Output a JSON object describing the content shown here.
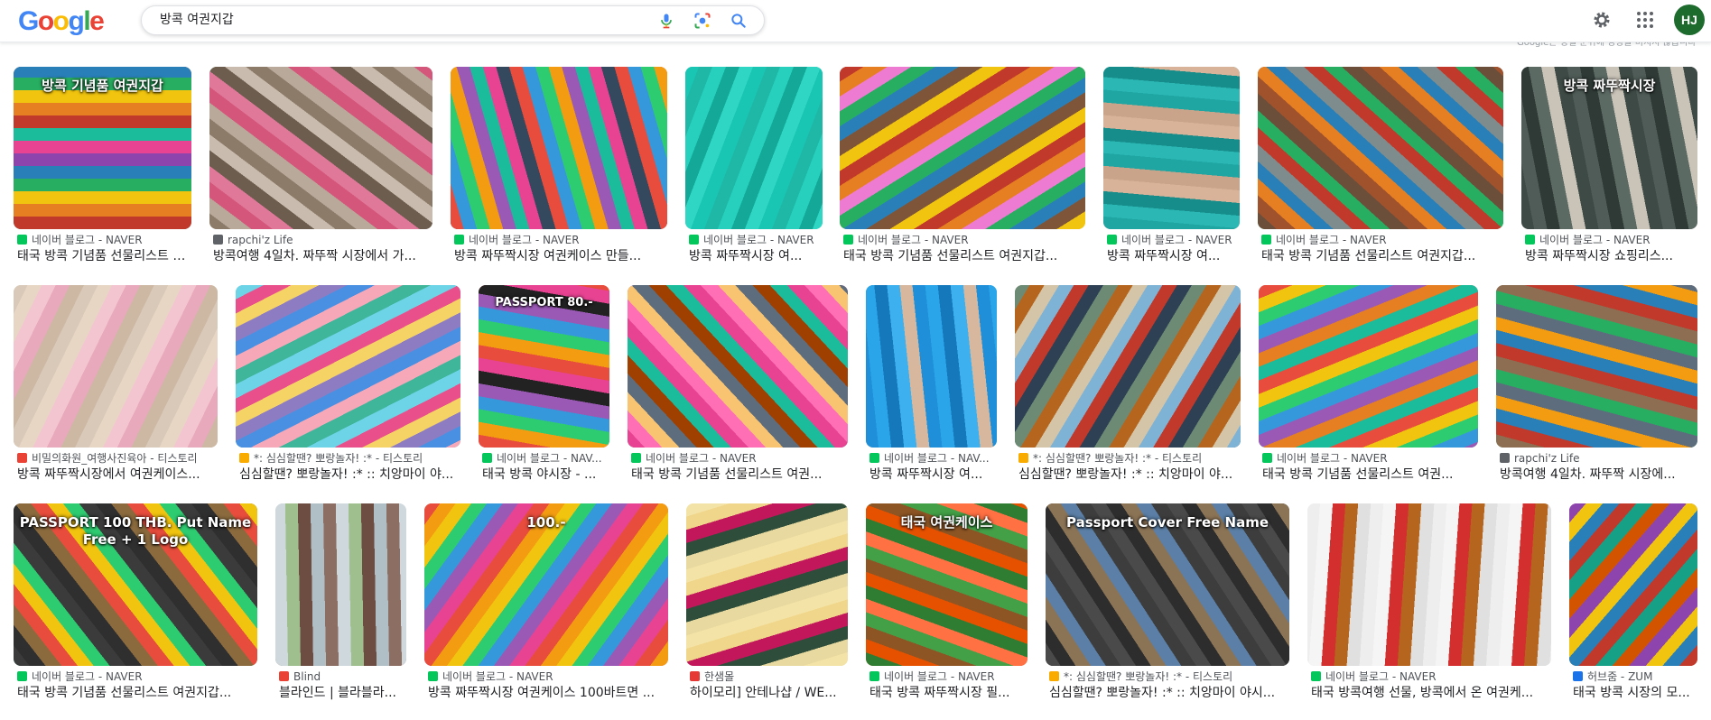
{
  "header": {
    "logo": [
      "G",
      "o",
      "o",
      "g",
      "l",
      "e"
    ],
    "logo_colors": [
      "#4285f4",
      "#ea4335",
      "#fbbc05",
      "#4285f4",
      "#34a853",
      "#ea4335"
    ],
    "search_value": "방콕 여권지갑",
    "avatar_initials": "HJ",
    "hint": "Google은 정렬 순위에 영향을 미치지 않습니다"
  },
  "results": [
    {
      "source": "네이버 블로그 - NAVER",
      "title": "태국 방콕 기념품 선물리스트 여권지갑...",
      "overlay": "방콕 기념품 여권지갑",
      "fav": "#03c75a"
    },
    {
      "source": "rapchi'z Life",
      "title": "방콕여행 4일차. 짜뚜짝 시장에서 가...",
      "fav": "#5f6368"
    },
    {
      "source": "네이버 블로그 - NAVER",
      "title": "방콕 짜뚜짝시장 여권케이스 만들...",
      "fav": "#03c75a"
    },
    {
      "source": "네이버 블로그 - NAVER",
      "title": "방콕 짜뚜짝시장 여...",
      "fav": "#03c75a"
    },
    {
      "source": "네이버 블로그 - NAVER",
      "title": "태국 방콕 기념품 선물리스트 여권지갑...",
      "fav": "#03c75a"
    },
    {
      "source": "네이버 블로그 - NAVER",
      "title": "방콕 짜뚜짝시장 여...",
      "fav": "#03c75a"
    },
    {
      "source": "네이버 블로그 - NAVER",
      "title": "태국 방콕 기념품 선물리스트 여권지갑...",
      "fav": "#03c75a"
    },
    {
      "source": "네이버 블로그 - NAVER",
      "title": "방콕 짜뚜짝시장 쇼핑리스...",
      "overlay": "방콕 짜뚜짝시장",
      "fav": "#03c75a"
    },
    {
      "source": "비밀의화원_여행사진육아 - 티스토리",
      "title": "방콕 짜뚜짝시장에서 여권케이스...",
      "fav": "#ea4335"
    },
    {
      "source": "*: 심심할땐? 뽀랑놀자! :* - 티스토리",
      "title": "심심할땐? 뽀랑놀자! :* :: 치앙마이 야...",
      "fav": "#f9ab00"
    },
    {
      "source": "네이버 블로그 - NAV...",
      "title": "태국 방콕 야시장 - ...",
      "overlay": "PASSPORT 80.-",
      "fav": "#03c75a"
    },
    {
      "source": "네이버 블로그 - NAVER",
      "title": "태국 방콕 기념품 선물리스트 여권...",
      "fav": "#03c75a"
    },
    {
      "source": "네이버 블로그 - NAV...",
      "title": "방콕 짜뚜짝시장 여...",
      "fav": "#03c75a"
    },
    {
      "source": "*: 심심할땐? 뽀랑놀자! :* - 티스토리",
      "title": "심심할땐? 뽀랑놀자! :* :: 치앙마이 야...",
      "fav": "#f9ab00"
    },
    {
      "source": "네이버 블로그 - NAVER",
      "title": "태국 방콕 기념품 선물리스트 여권...",
      "fav": "#03c75a"
    },
    {
      "source": "rapchi'z Life",
      "title": "방콕여행 4일차. 짜뚜짝 시장에...",
      "fav": "#5f6368"
    },
    {
      "source": "네이버 블로그 - NAVER",
      "title": "태국 방콕 기념품 선물리스트 여권지갑...",
      "overlay": "PASSPORT 100 THB. Put Name Free + 1 Logo",
      "fav": "#03c75a"
    },
    {
      "source": "Blind",
      "title": "블라인드 | 블라블라...",
      "fav": "#ea4335"
    },
    {
      "source": "네이버 블로그 - NAVER",
      "title": "방콕 짜뚜짝시장 여권케이스 100바트면 ...",
      "overlay": "100.-",
      "fav": "#03c75a"
    },
    {
      "source": "한샘몰",
      "title": "하이모리] 안테나샵 / WE...",
      "fav": "#e53935"
    },
    {
      "source": "네이버 블로그 - NAVER",
      "title": "태국 방콕 짜뚜짝시장 필...",
      "overlay": "태국 여권케이스",
      "fav": "#03c75a"
    },
    {
      "source": "*: 심심할땐? 뽀랑놀자! :* - 티스토리",
      "title": "심심할땐? 뽀랑놀자! :* :: 치앙마이 야시...",
      "overlay": "Passport Cover Free Name",
      "fav": "#f9ab00"
    },
    {
      "source": "네이버 블로그 - NAVER",
      "title": "태국 방콕여행 선물, 방콕에서 온 여권케...",
      "fav": "#03c75a"
    },
    {
      "source": "허브줌 - ZUM",
      "title": "태국 방콕 시장의 모...",
      "fav": "#1a73e8"
    }
  ]
}
